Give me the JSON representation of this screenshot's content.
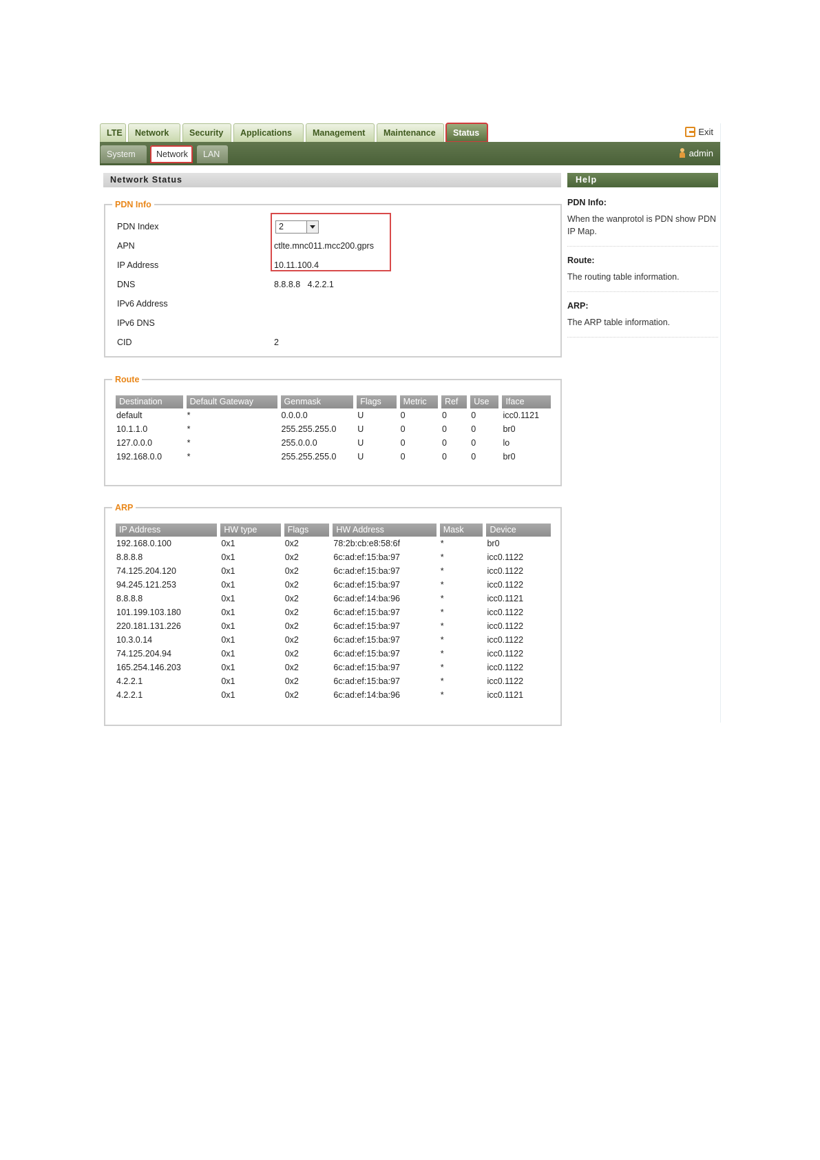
{
  "top_tabs": [
    "LTE",
    "Network",
    "Security",
    "Applications",
    "Management",
    "Maintenance",
    "Status"
  ],
  "exit_label": "Exit",
  "sub_tabs": [
    "System",
    "Network",
    "LAN"
  ],
  "user": "admin",
  "page_title": "Network Status",
  "pdn": {
    "legend": "PDN Info",
    "labels": [
      "PDN Index",
      "APN",
      "IP Address",
      "DNS",
      "IPv6 Address",
      "IPv6 DNS",
      "CID"
    ],
    "index_value": "2",
    "apn": "ctlte.mnc011.mcc200.gprs",
    "ip_address": "10.11.100.4",
    "dns": "8.8.8.8   4.2.2.1",
    "ipv6_address": "",
    "ipv6_dns": "",
    "cid": "2"
  },
  "route": {
    "legend": "Route",
    "headers": [
      "Destination",
      "Default Gateway",
      "Genmask",
      "Flags",
      "Metric",
      "Ref",
      "Use",
      "Iface"
    ],
    "rows": [
      [
        "default",
        "*",
        "0.0.0.0",
        "U",
        "0",
        "0",
        "0",
        "icc0.1121"
      ],
      [
        "10.1.1.0",
        "*",
        "255.255.255.0",
        "U",
        "0",
        "0",
        "0",
        "br0"
      ],
      [
        "127.0.0.0",
        "*",
        "255.0.0.0",
        "U",
        "0",
        "0",
        "0",
        "lo"
      ],
      [
        "192.168.0.0",
        "*",
        "255.255.255.0",
        "U",
        "0",
        "0",
        "0",
        "br0"
      ]
    ]
  },
  "arp": {
    "legend": "ARP",
    "headers": [
      "IP Address",
      "HW type",
      "Flags",
      "HW Address",
      "Mask",
      "Device"
    ],
    "rows": [
      [
        "192.168.0.100",
        "0x1",
        "0x2",
        "78:2b:cb:e8:58:6f",
        "*",
        "br0"
      ],
      [
        "8.8.8.8",
        "0x1",
        "0x2",
        "6c:ad:ef:15:ba:97",
        "*",
        "icc0.1122"
      ],
      [
        "74.125.204.120",
        "0x1",
        "0x2",
        "6c:ad:ef:15:ba:97",
        "*",
        "icc0.1122"
      ],
      [
        "94.245.121.253",
        "0x1",
        "0x2",
        "6c:ad:ef:15:ba:97",
        "*",
        "icc0.1122"
      ],
      [
        "8.8.8.8",
        "0x1",
        "0x2",
        "6c:ad:ef:14:ba:96",
        "*",
        "icc0.1121"
      ],
      [
        "101.199.103.180",
        "0x1",
        "0x2",
        "6c:ad:ef:15:ba:97",
        "*",
        "icc0.1122"
      ],
      [
        "220.181.131.226",
        "0x1",
        "0x2",
        "6c:ad:ef:15:ba:97",
        "*",
        "icc0.1122"
      ],
      [
        "10.3.0.14",
        "0x1",
        "0x2",
        "6c:ad:ef:15:ba:97",
        "*",
        "icc0.1122"
      ],
      [
        "74.125.204.94",
        "0x1",
        "0x2",
        "6c:ad:ef:15:ba:97",
        "*",
        "icc0.1122"
      ],
      [
        "165.254.146.203",
        "0x1",
        "0x2",
        "6c:ad:ef:15:ba:97",
        "*",
        "icc0.1122"
      ],
      [
        "4.2.2.1",
        "0x1",
        "0x2",
        "6c:ad:ef:15:ba:97",
        "*",
        "icc0.1122"
      ],
      [
        "4.2.2.1",
        "0x1",
        "0x2",
        "6c:ad:ef:14:ba:96",
        "*",
        "icc0.1121"
      ]
    ]
  },
  "help": {
    "title": "Help",
    "items": [
      {
        "title": "PDN Info:",
        "text": "When the wanprotol is PDN show PDN IP Map."
      },
      {
        "title": "Route:",
        "text": "The routing table information."
      },
      {
        "title": "ARP:",
        "text": "The ARP table information."
      }
    ]
  },
  "colors": {
    "accent_green": "#4a6138",
    "legend_orange": "#e9871a",
    "highlight_red": "#d03b3b"
  },
  "icons": [
    "exit-icon",
    "user-icon",
    "dropdown-arrow-icon"
  ]
}
